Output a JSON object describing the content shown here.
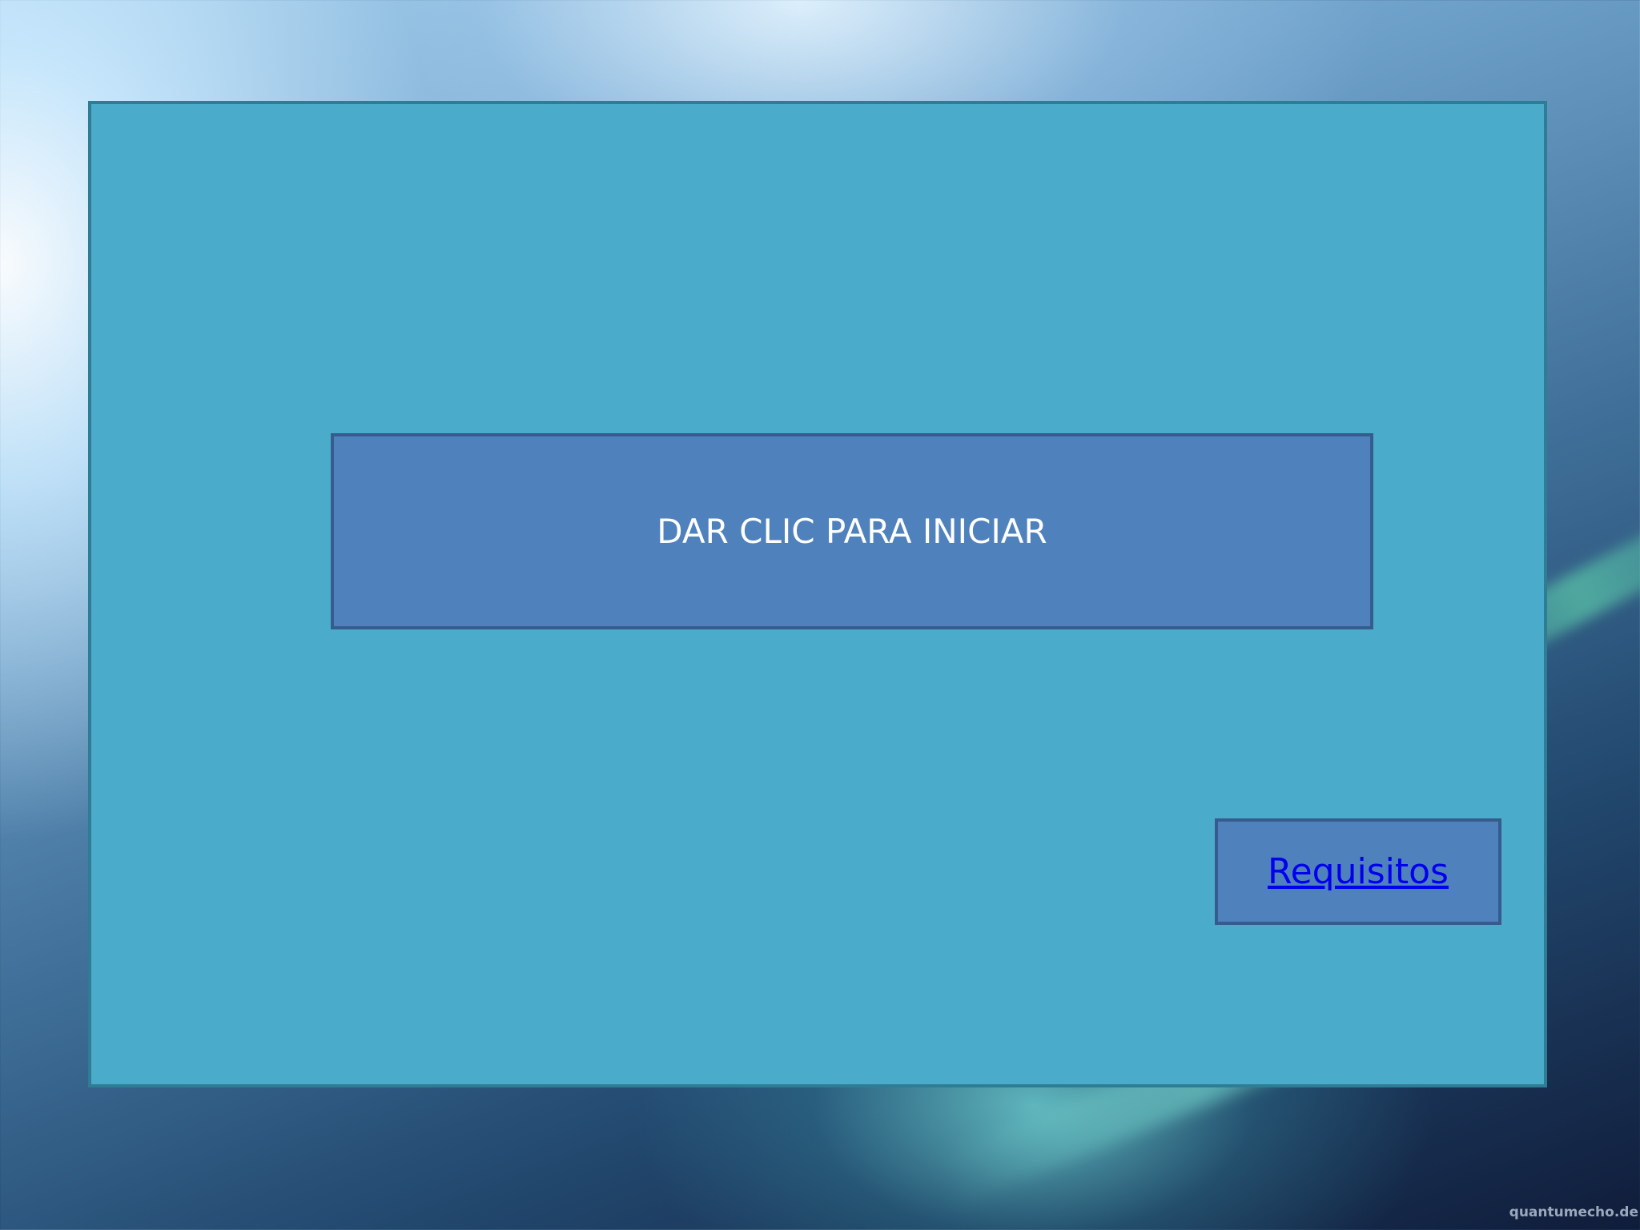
{
  "slide": {
    "start_button_label": "DAR CLIC PARA INICIAR",
    "requirements_link_label": "Requisitos",
    "watermark_text": "quantumecho.de"
  },
  "colors": {
    "panel": "#4babcb",
    "button": "#4f81bd",
    "link": "#0000ee"
  }
}
